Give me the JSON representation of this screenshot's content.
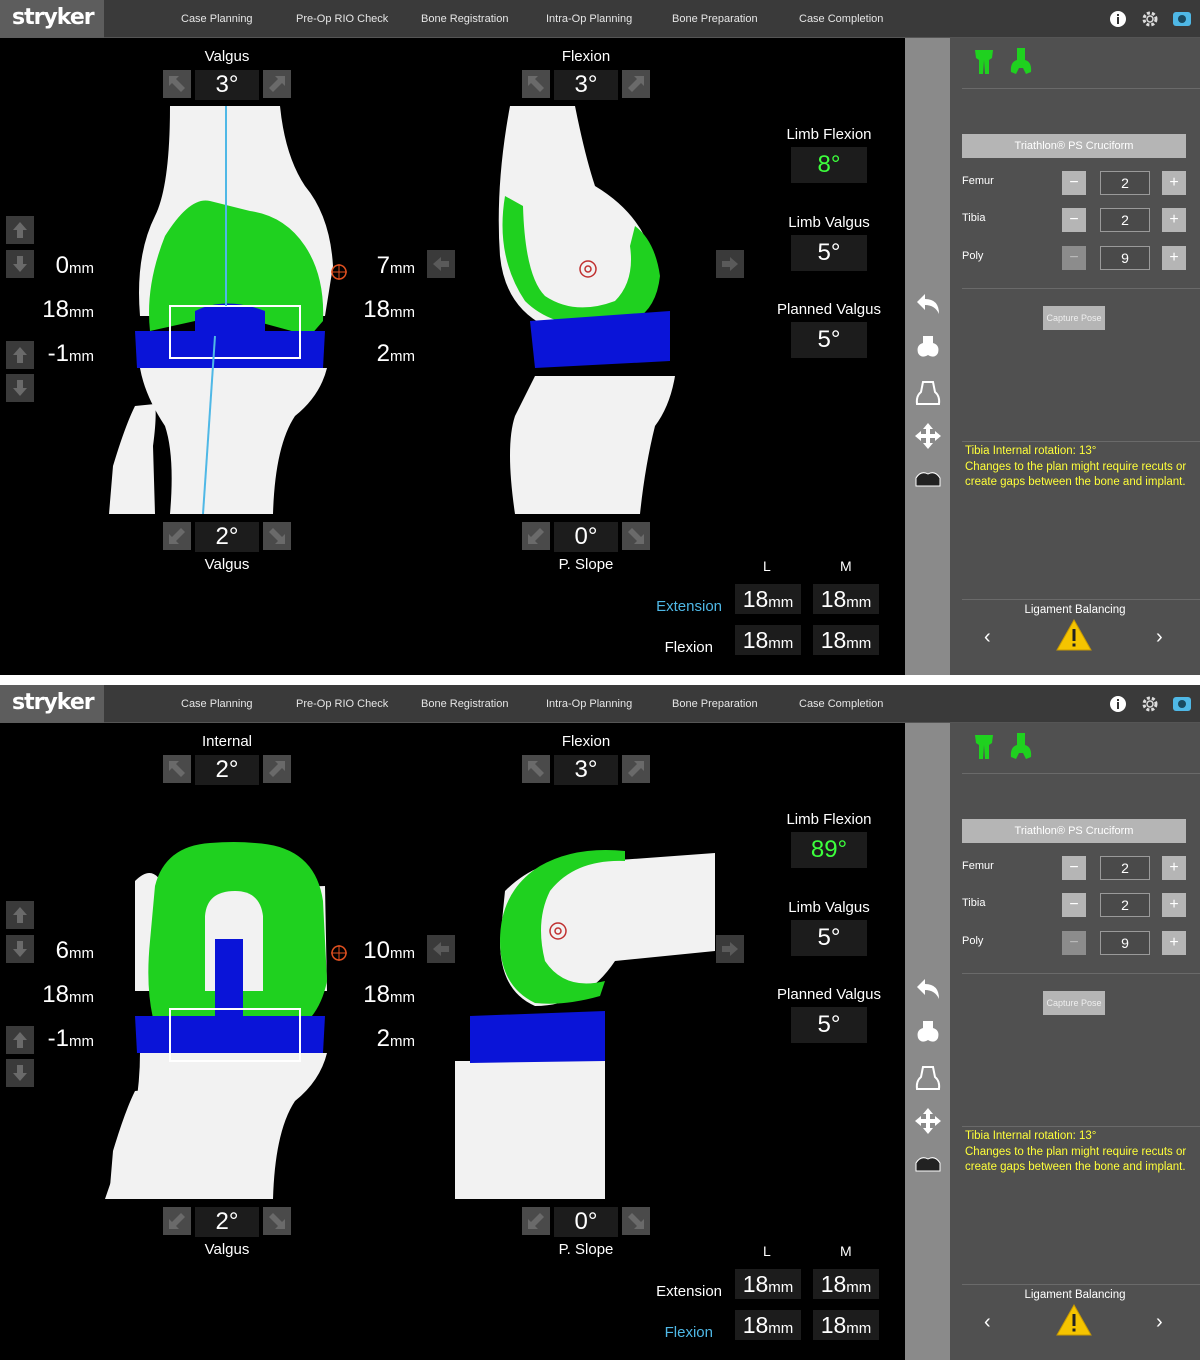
{
  "app": {
    "logo": "stryker",
    "nav": [
      "Case Planning",
      "Pre-Op RIO Check",
      "Bone Registration",
      "Intra-Op Planning",
      "Bone Preparation",
      "Case Completion"
    ],
    "icons": [
      "info-icon",
      "gear-icon",
      "camera-icon"
    ]
  },
  "panels": [
    {
      "coronal_top": {
        "label": "Valgus",
        "value": "3°"
      },
      "sagittal_top": {
        "label": "Flexion",
        "value": "3°"
      },
      "coronal_bottom": {
        "label": "Valgus",
        "value": "2°"
      },
      "sagittal_bottom": {
        "label": "P. Slope",
        "value": "0°"
      },
      "left_gaps": [
        {
          "num": "0",
          "unit": "mm"
        },
        {
          "num": "18",
          "unit": "mm"
        },
        {
          "num": "-1",
          "unit": "mm"
        }
      ],
      "right_gaps": [
        {
          "num": "7",
          "unit": "mm"
        },
        {
          "num": "18",
          "unit": "mm"
        },
        {
          "num": "2",
          "unit": "mm"
        }
      ],
      "limb_flexion": {
        "label": "Limb Flexion",
        "value": "8°"
      },
      "limb_valgus": {
        "label": "Limb Valgus",
        "value": "5°"
      },
      "planned_valgus": {
        "label": "Planned Valgus",
        "value": "5°"
      },
      "table": {
        "col_l": "L",
        "col_m": "M",
        "row1_label": "Extension",
        "row2_label": "Flexion",
        "active_row": "extension",
        "ext_l": {
          "num": "18",
          "unit": "mm"
        },
        "ext_m": {
          "num": "18",
          "unit": "mm"
        },
        "flex_l": {
          "num": "18",
          "unit": "mm"
        },
        "flex_m": {
          "num": "18",
          "unit": "mm"
        }
      },
      "pose": "extension"
    },
    {
      "coronal_top": {
        "label": "Internal",
        "value": "2°"
      },
      "sagittal_top": {
        "label": "Flexion",
        "value": "3°"
      },
      "coronal_bottom": {
        "label": "Valgus",
        "value": "2°"
      },
      "sagittal_bottom": {
        "label": "P. Slope",
        "value": "0°"
      },
      "left_gaps": [
        {
          "num": "6",
          "unit": "mm"
        },
        {
          "num": "18",
          "unit": "mm"
        },
        {
          "num": "-1",
          "unit": "mm"
        }
      ],
      "right_gaps": [
        {
          "num": "10",
          "unit": "mm"
        },
        {
          "num": "18",
          "unit": "mm"
        },
        {
          "num": "2",
          "unit": "mm"
        }
      ],
      "limb_flexion": {
        "label": "Limb Flexion",
        "value": "89°"
      },
      "limb_valgus": {
        "label": "Limb Valgus",
        "value": "5°"
      },
      "planned_valgus": {
        "label": "Planned Valgus",
        "value": "5°"
      },
      "table": {
        "col_l": "L",
        "col_m": "M",
        "row1_label": "Extension",
        "row2_label": "Flexion",
        "active_row": "flexion",
        "ext_l": {
          "num": "18",
          "unit": "mm"
        },
        "ext_m": {
          "num": "18",
          "unit": "mm"
        },
        "flex_l": {
          "num": "18",
          "unit": "mm"
        },
        "flex_m": {
          "num": "18",
          "unit": "mm"
        }
      },
      "pose": "flexion"
    }
  ],
  "right_panel": {
    "implant": "Triathlon® PS Cruciform",
    "sizes": [
      {
        "label": "Femur",
        "value": "2"
      },
      {
        "label": "Tibia",
        "value": "2"
      },
      {
        "label": "Poly",
        "value": "9"
      }
    ],
    "minus": "−",
    "plus": "+",
    "capture_label": "Capture Pose",
    "warning": "Tibia Internal rotation: 13°\nChanges to the plan might require recuts or create gaps between the bone and implant.",
    "ligament_label": "Ligament Balancing",
    "prev": "‹",
    "next": "›"
  },
  "tools": [
    "undo-icon",
    "femur-view-icon",
    "tibia-view-icon",
    "move-icon",
    "poly-icon"
  ],
  "colors": {
    "implant_green": "#1fd11f",
    "poly_blue": "#0a14d8",
    "highlight_green": "#3cff3c",
    "highlight_blue": "#4fb8e6",
    "warning_yellow": "#ffff3a",
    "bone": "#f2f2f2"
  }
}
